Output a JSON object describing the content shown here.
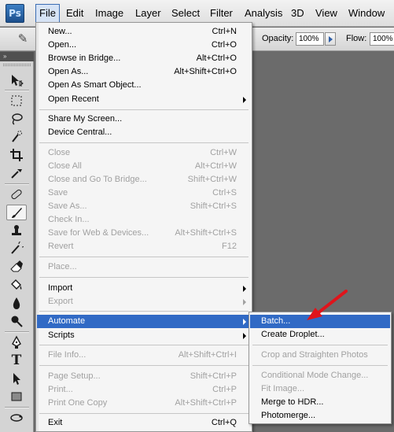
{
  "menubar": {
    "logo": "Ps",
    "items": [
      "File",
      "Edit",
      "Image",
      "Layer",
      "Select",
      "Filter",
      "Analysis",
      "3D",
      "View",
      "Window"
    ],
    "active": "File"
  },
  "options": {
    "opacity_label": "Opacity:",
    "opacity_value": "100%",
    "flow_label": "Flow:",
    "flow_value": "100%"
  },
  "tools_panel": {
    "header": "»",
    "tools": [
      "move-tool",
      "marquee-tool",
      "lasso-tool",
      "quick-selection-tool",
      "crop-tool",
      "eyedropper-tool",
      "healing-brush-tool",
      "brush-tool",
      "clone-stamp-tool",
      "history-brush-tool",
      "eraser-tool",
      "paint-bucket-tool",
      "blur-tool",
      "dodge-tool",
      "pen-tool",
      "type-tool",
      "path-selection-tool",
      "shape-tool",
      "3d-rotate-tool"
    ],
    "selected": "brush-tool"
  },
  "file_menu": {
    "items": [
      {
        "label": "New...",
        "shortcut": "Ctrl+N"
      },
      {
        "label": "Open...",
        "shortcut": "Ctrl+O"
      },
      {
        "label": "Browse in Bridge...",
        "shortcut": "Alt+Ctrl+O"
      },
      {
        "label": "Open As...",
        "shortcut": "Alt+Shift+Ctrl+O"
      },
      {
        "label": "Open As Smart Object..."
      },
      {
        "label": "Open Recent",
        "submenu": true
      },
      {
        "label": "Share My Screen..."
      },
      {
        "label": "Device Central..."
      },
      {
        "label": "Close",
        "shortcut": "Ctrl+W",
        "disabled": true
      },
      {
        "label": "Close All",
        "shortcut": "Alt+Ctrl+W",
        "disabled": true
      },
      {
        "label": "Close and Go To Bridge...",
        "shortcut": "Shift+Ctrl+W",
        "disabled": true
      },
      {
        "label": "Save",
        "shortcut": "Ctrl+S",
        "disabled": true
      },
      {
        "label": "Save As...",
        "shortcut": "Shift+Ctrl+S",
        "disabled": true
      },
      {
        "label": "Check In...",
        "disabled": true
      },
      {
        "label": "Save for Web & Devices...",
        "shortcut": "Alt+Shift+Ctrl+S",
        "disabled": true
      },
      {
        "label": "Revert",
        "shortcut": "F12",
        "disabled": true
      },
      {
        "label": "Place...",
        "disabled": true
      },
      {
        "label": "Import",
        "submenu": true
      },
      {
        "label": "Export",
        "submenu": true,
        "disabled": true
      },
      {
        "label": "Automate",
        "submenu": true,
        "highlighted": true
      },
      {
        "label": "Scripts",
        "submenu": true
      },
      {
        "label": "File Info...",
        "shortcut": "Alt+Shift+Ctrl+I",
        "disabled": true
      },
      {
        "label": "Page Setup...",
        "shortcut": "Shift+Ctrl+P",
        "disabled": true
      },
      {
        "label": "Print...",
        "shortcut": "Ctrl+P",
        "disabled": true
      },
      {
        "label": "Print One Copy",
        "shortcut": "Alt+Shift+Ctrl+P",
        "disabled": true
      },
      {
        "label": "Exit",
        "shortcut": "Ctrl+Q"
      }
    ]
  },
  "automate_submenu": {
    "items": [
      {
        "label": "Batch...",
        "highlighted": true
      },
      {
        "label": "Create Droplet..."
      },
      {
        "label": "Crop and Straighten Photos",
        "disabled": true
      },
      {
        "label": "Conditional Mode Change...",
        "disabled": true
      },
      {
        "label": "Fit Image...",
        "disabled": true
      },
      {
        "label": "Merge to HDR..."
      },
      {
        "label": "Photomerge..."
      }
    ]
  },
  "colors": {
    "highlight": "#316ac5",
    "annotation_arrow": "#e0141b",
    "canvas_background": "#6b6b6b"
  }
}
